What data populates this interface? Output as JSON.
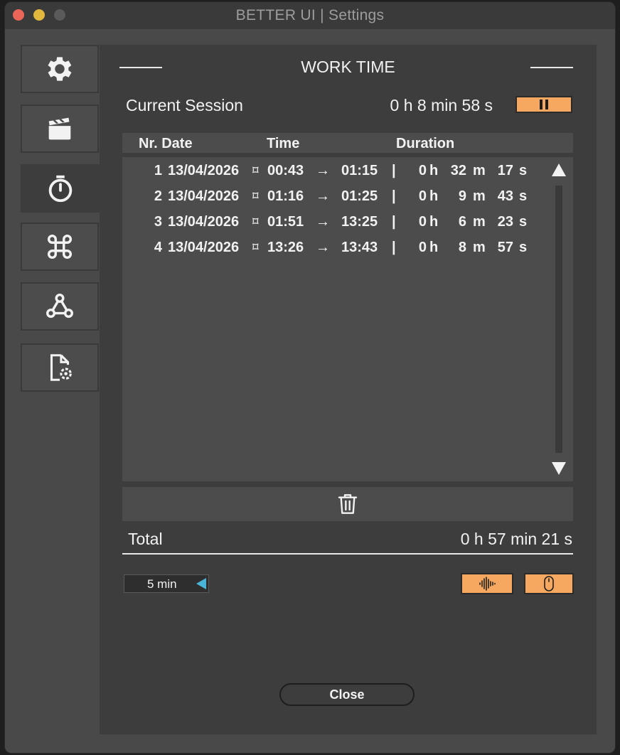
{
  "window": {
    "title": "BETTER UI | Settings"
  },
  "sidebar": {
    "tabs": [
      {
        "icon": "gear-icon",
        "active": false
      },
      {
        "icon": "clapperboard-icon",
        "active": false
      },
      {
        "icon": "stopwatch-icon",
        "active": true
      },
      {
        "icon": "command-icon",
        "active": false
      },
      {
        "icon": "webhook-icon",
        "active": false
      },
      {
        "icon": "file-settings-icon",
        "active": false
      }
    ]
  },
  "work_time": {
    "title": "WORK TIME",
    "current_session_label": "Current Session",
    "current_session_value": "0 h 8 min 58 s",
    "pause_icon": "pause-icon",
    "columns": {
      "nr_date": "Nr. Date",
      "time": "Time",
      "duration": "Duration"
    },
    "rows": [
      {
        "nr": "1",
        "date": "13/04/2026",
        "start": "00:43",
        "end": "01:15",
        "h": "0",
        "m": "32",
        "s": "17"
      },
      {
        "nr": "2",
        "date": "13/04/2026",
        "start": "01:16",
        "end": "01:25",
        "h": "0",
        "m": "9",
        "s": "43"
      },
      {
        "nr": "3",
        "date": "13/04/2026",
        "start": "01:51",
        "end": "13:25",
        "h": "0",
        "m": "6",
        "s": "23"
      },
      {
        "nr": "4",
        "date": "13/04/2026",
        "start": "13:26",
        "end": "13:43",
        "h": "0",
        "m": "8",
        "s": "57"
      }
    ],
    "separator_glyph": "⌑",
    "arrow_glyph": "→",
    "pipe_glyph": "|",
    "unit_h": "h",
    "unit_m": "m",
    "unit_s": "s",
    "total_label": "Total",
    "total_value": "0 h 57 min 21 s",
    "interval_value": "5 min",
    "close_label": "Close"
  }
}
